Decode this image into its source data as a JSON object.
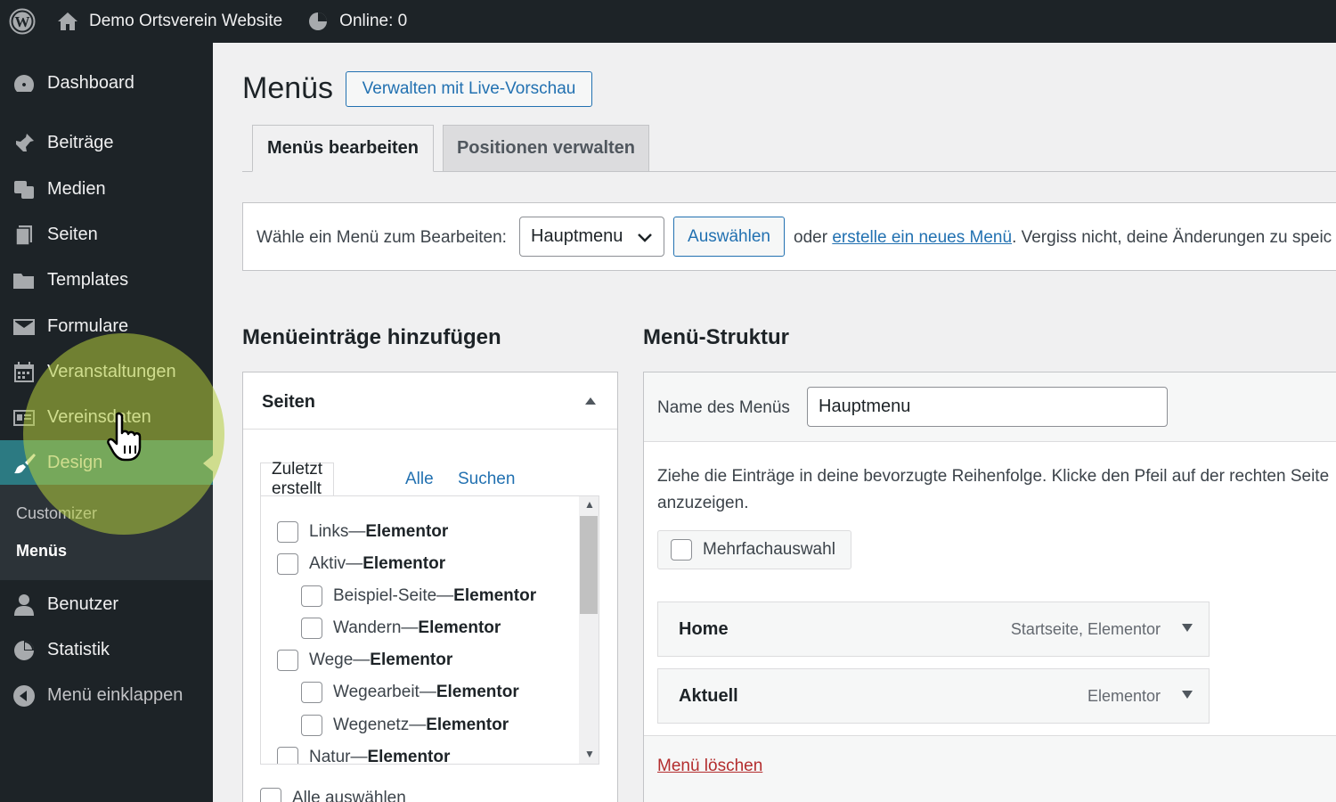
{
  "adminbar": {
    "site_name": "Demo Ortsverein Website",
    "online": "Online: 0"
  },
  "sidebar": {
    "items": [
      {
        "label": "Dashboard",
        "icon": "dashboard-icon"
      },
      {
        "label": "Beiträge",
        "icon": "pin-icon"
      },
      {
        "label": "Medien",
        "icon": "media-icon"
      },
      {
        "label": "Seiten",
        "icon": "pages-icon"
      },
      {
        "label": "Templates",
        "icon": "folder-icon"
      },
      {
        "label": "Formulare",
        "icon": "mail-icon"
      },
      {
        "label": "Veranstaltungen",
        "icon": "calendar-icon"
      },
      {
        "label": "Vereinsdaten",
        "icon": "id-card-icon"
      },
      {
        "label": "Design",
        "icon": "brush-icon"
      },
      {
        "label": "Benutzer",
        "icon": "user-icon"
      },
      {
        "label": "Statistik",
        "icon": "pie-chart-icon"
      },
      {
        "label": "Menü einklappen",
        "icon": "collapse-icon"
      }
    ],
    "submenu": [
      "Customizer",
      "Menüs"
    ]
  },
  "main": {
    "title": "Menüs",
    "live_preview_button": "Verwalten mit Live-Vorschau",
    "tabs": [
      "Menüs bearbeiten",
      "Positionen verwalten"
    ],
    "select_label": "Wähle ein Menü zum Bearbeiten:",
    "select_value": "Hauptmenu",
    "select_button": "Auswählen",
    "or_prefix": "oder ",
    "create_link": "erstelle ein neues Menü",
    "or_suffix": ". Vergiss nicht, deine Änderungen zu speic"
  },
  "add_items": {
    "heading": "Menüeinträge hinzufügen",
    "panel_title": "Seiten",
    "tabs": [
      "Zuletzt erstellt",
      "Alle",
      "Suchen"
    ],
    "pages": [
      {
        "title": "Links",
        "builder": "Elementor"
      },
      {
        "title": "Aktiv",
        "builder": "Elementor"
      },
      {
        "title": "Beispiel-Seite",
        "builder": "Elementor"
      },
      {
        "title": "Wandern",
        "builder": "Elementor"
      },
      {
        "title": "Wege",
        "builder": "Elementor"
      },
      {
        "title": "Wegearbeit",
        "builder": "Elementor"
      },
      {
        "title": "Wegenetz",
        "builder": "Elementor"
      },
      {
        "title": "Natur",
        "builder": "Elementor"
      }
    ],
    "separator": " — ",
    "select_all": "Alle auswählen"
  },
  "structure": {
    "heading": "Menü-Struktur",
    "name_label": "Name des Menüs",
    "name_value": "Hauptmenu",
    "hint": "Ziehe die Einträge in deine bevorzugte Reihenfolge. Klicke den Pfeil auf der rechten Seite anzuzeigen.",
    "multi_select": "Mehrfachauswahl",
    "entries": [
      {
        "title": "Home",
        "meta": "Startseite, Elementor"
      },
      {
        "title": "Aktuell",
        "meta": "Elementor"
      }
    ],
    "delete_link": "Menü löschen"
  }
}
